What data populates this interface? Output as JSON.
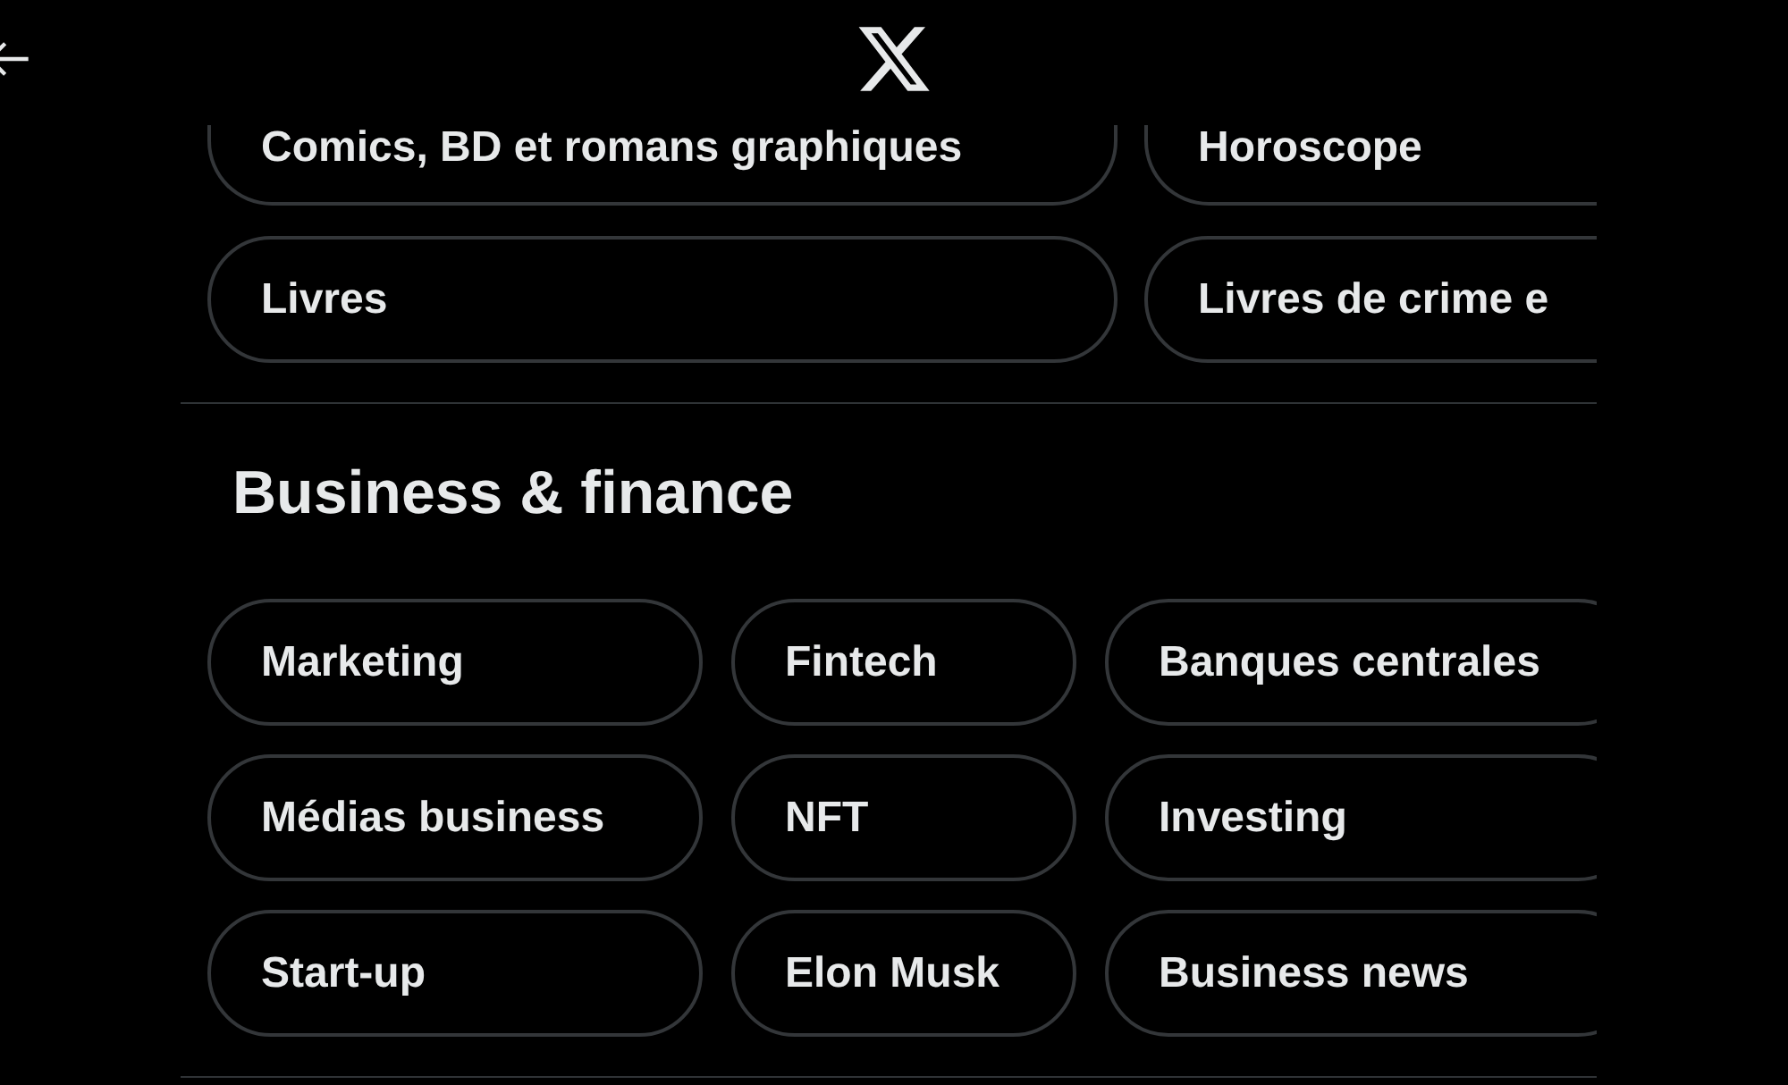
{
  "sections": [
    {
      "topics": [
        "Comics, BD et romans graphiques",
        "Horoscope",
        "Livres",
        "Livres de crime e"
      ]
    },
    {
      "heading": "Business & finance",
      "topics": [
        "Marketing",
        "Fintech",
        "Banques centrales",
        "Médias business",
        "NFT",
        "Investing",
        "Start-up",
        "Elon Musk",
        "Business news"
      ]
    }
  ]
}
